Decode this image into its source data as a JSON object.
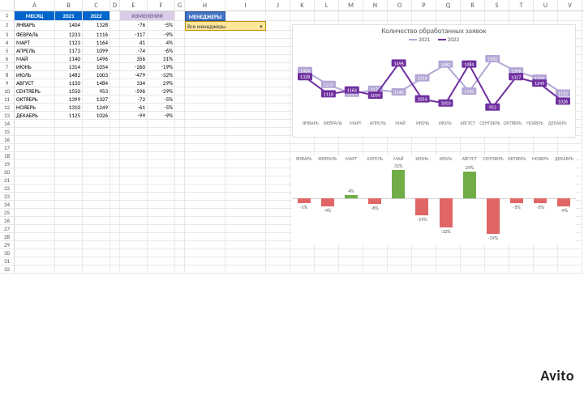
{
  "columns": {
    "letters": [
      "A",
      "B",
      "C",
      "D",
      "E",
      "F",
      "G",
      "H",
      "I",
      "J",
      "K",
      "L",
      "M",
      "N",
      "O",
      "P",
      "Q",
      "R",
      "S",
      "T",
      "U",
      "V"
    ],
    "widths": [
      50,
      34,
      34,
      12,
      34,
      34,
      12,
      50,
      50,
      30,
      30,
      30,
      30,
      30,
      30,
      30,
      30,
      30,
      30,
      30,
      30,
      30
    ]
  },
  "headers": {
    "month": "МЕСЯЦ",
    "y2021": "2021",
    "y2022": "2022",
    "change": "ИЗМЕНЕНИЯ",
    "managers": "МЕНЕДЖЕРЫ",
    "filter_value": "Все менеджеры"
  },
  "table": {
    "rows": [
      {
        "m": "ЯНВАРЬ",
        "a": 1404,
        "b": 1328,
        "d": -76,
        "p": "-5%"
      },
      {
        "m": "ФЕВРАЛЬ",
        "a": 1233,
        "b": 1116,
        "d": -117,
        "p": "-9%"
      },
      {
        "m": "МАРТ",
        "a": 1123,
        "b": 1164,
        "d": 41,
        "p": "4%"
      },
      {
        "m": "АПРЕЛЬ",
        "a": 1173,
        "b": 1099,
        "d": -74,
        "p": "-6%"
      },
      {
        "m": "МАЙ",
        "a": 1140,
        "b": 1496,
        "d": 356,
        "p": "31%"
      },
      {
        "m": "ИЮНЬ",
        "a": 1314,
        "b": 1054,
        "d": -260,
        "p": "-19%"
      },
      {
        "m": "ИЮЛЬ",
        "a": 1482,
        "b": 1003,
        "d": -479,
        "p": "-32%"
      },
      {
        "m": "АВГУСТ",
        "a": 1150,
        "b": 1484,
        "d": 334,
        "p": "29%"
      },
      {
        "m": "СЕНТЯБРЬ",
        "a": 1550,
        "b": 953,
        "d": -596,
        "p": "-39%"
      },
      {
        "m": "ОКТЯБРЬ",
        "a": 1399,
        "b": 1327,
        "d": -72,
        "p": "-5%"
      },
      {
        "m": "НОЯБРЬ",
        "a": 1310,
        "b": 1249,
        "d": -61,
        "p": "-5%"
      },
      {
        "m": "ДЕКАБРЬ",
        "a": 1125,
        "b": 1026,
        "d": -99,
        "p": "-9%"
      }
    ]
  },
  "chart_data": [
    {
      "type": "line",
      "title": "Количество обработанных заявок",
      "categories": [
        "ЯНВАРЬ",
        "ФЕВРАЛЬ",
        "МАРТ",
        "АПРЕЛЬ",
        "МАЙ",
        "ИЮНЬ",
        "ИЮЛЬ",
        "АВГУСТ",
        "СЕНТЯБРЬ",
        "ОКТЯБРЬ",
        "НОЯБРЬ",
        "ДЕКАБРЬ"
      ],
      "series": [
        {
          "name": "2021",
          "color": "#b4a7d6",
          "values": [
            1404,
            1233,
            1123,
            1173,
            1140,
            1314,
            1482,
            1150,
            1550,
            1399,
            1310,
            1125
          ]
        },
        {
          "name": "2022",
          "color": "#7030a0",
          "values": [
            1328,
            1116,
            1164,
            1099,
            1496,
            1054,
            1003,
            1484,
            953,
            1327,
            1249,
            1026
          ]
        }
      ],
      "ylim": [
        900,
        1600
      ]
    },
    {
      "type": "bar",
      "categories": [
        "ЯНВАРЬ",
        "ФЕВРАЛЬ",
        "МАРТ",
        "АПРЕЛЬ",
        "МАЙ",
        "ИЮНЬ",
        "ИЮЛЬ",
        "АВГУСТ",
        "СЕНТЯБРЬ",
        "ОКТЯБРЬ",
        "НОЯБРЬ",
        "ДЕКАБРЬ"
      ],
      "values_pct": [
        -5,
        -9,
        4,
        -6,
        31,
        -19,
        -32,
        29,
        -39,
        -5,
        -5,
        -9
      ],
      "labels": [
        "-5%",
        "-9%",
        "4%",
        "-6%",
        "31%",
        "-19%",
        "-32%",
        "29%",
        "-39%",
        "-5%",
        "-5%",
        "-9%"
      ],
      "pos_color": "#70ad47",
      "neg_color": "#e06666",
      "ylim": [
        -40,
        40
      ]
    }
  ],
  "watermark": "Avito",
  "row_count_visible": 32
}
